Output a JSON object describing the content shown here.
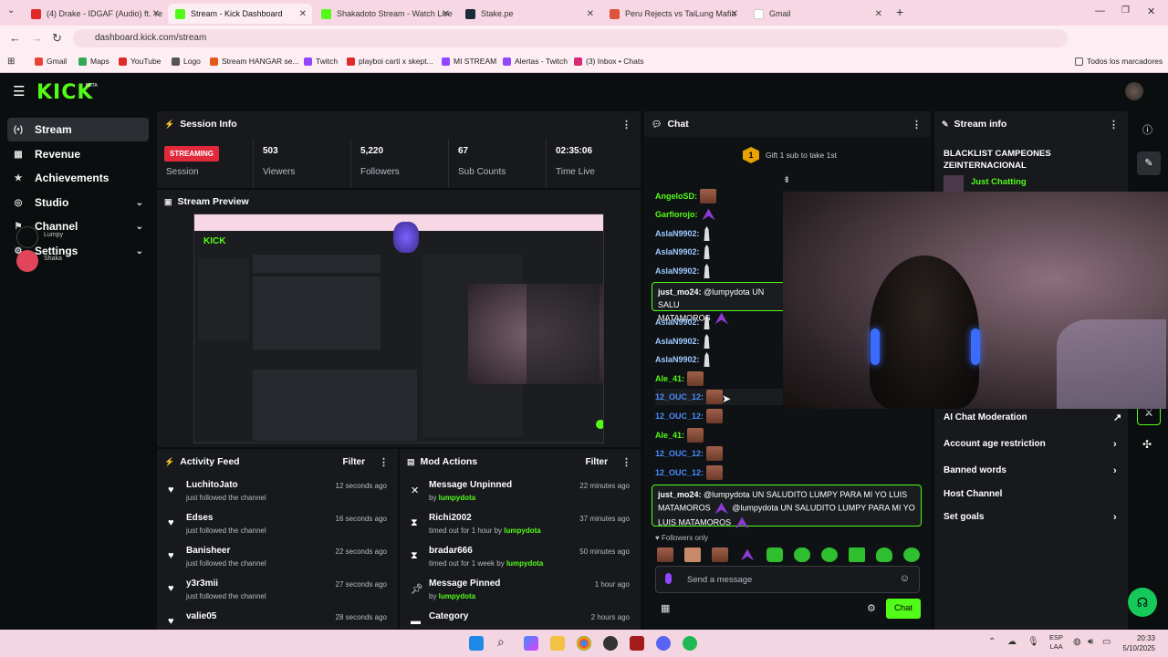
{
  "browser": {
    "tabs": [
      {
        "label": "(4) Drake - IDGAF (Audio) ft. Ye",
        "color": "#e02a2a"
      },
      {
        "label": "Stream - Kick Dashboard",
        "color": "#53fc18",
        "active": true
      },
      {
        "label": "Shakadoto Stream - Watch Live",
        "color": "#53fc18"
      },
      {
        "label": "Stake.pe",
        "color": "#1a2c38"
      },
      {
        "label": "Peru Rejects vs TaiLung Mafia",
        "color": "#e0533b"
      },
      {
        "label": "Gmail",
        "color": "#ffffff"
      }
    ],
    "url": "dashboard.kick.com/stream",
    "bookmarks": [
      "Gmail",
      "Maps",
      "YouTube",
      "Logo",
      "Stream HANGAR se...",
      "Twitch",
      "playboi carti x skept...",
      "MI STREAM",
      "Alertas - Twitch",
      "(3) Inbox • Chats"
    ],
    "bookmarks_all": "Todos los marcadores"
  },
  "sidebar": {
    "items": [
      {
        "label": "Stream",
        "icon": "broadcast-icon"
      },
      {
        "label": "Revenue",
        "icon": "revenue-icon"
      },
      {
        "label": "Achievements",
        "icon": "trophy-icon"
      },
      {
        "label": "Studio",
        "icon": "studio-icon"
      },
      {
        "label": "Channel",
        "icon": "channel-icon"
      },
      {
        "label": "Settings",
        "icon": "gear-icon"
      }
    ],
    "overlay_users": [
      "Lumpy",
      "Shaka"
    ]
  },
  "session": {
    "title": "Session Info",
    "status": "STREAMING",
    "status_label": "Session",
    "stats": [
      {
        "value": "503",
        "label": "Viewers"
      },
      {
        "value": "5,220",
        "label": "Followers"
      },
      {
        "value": "67",
        "label": "Sub Counts"
      },
      {
        "value": "02:35:06",
        "label": "Time Live"
      }
    ]
  },
  "preview": {
    "title": "Stream Preview"
  },
  "activity": {
    "title": "Activity Feed",
    "filter": "Filter",
    "items": [
      {
        "name": "LuchitoJato",
        "sub": "just followed the channel",
        "time": "12 seconds ago"
      },
      {
        "name": "Edses",
        "sub": "just followed the channel",
        "time": "16 seconds ago"
      },
      {
        "name": "Banisheer",
        "sub": "just followed the channel",
        "time": "22 seconds ago"
      },
      {
        "name": "y3r3mii",
        "sub": "just followed the channel",
        "time": "27 seconds ago"
      },
      {
        "name": "valie05",
        "sub": "",
        "time": "28 seconds ago"
      }
    ]
  },
  "mod": {
    "title": "Mod Actions",
    "filter": "Filter",
    "items": [
      {
        "name": "Message Unpinned",
        "sub_pre": "by ",
        "by": "lumpydota",
        "time": "22 minutes ago",
        "icon": "unpin-icon"
      },
      {
        "name": "Richi2002",
        "sub_pre": "timed out for 1 hour by ",
        "by": "lumpydota",
        "time": "37 minutes ago",
        "icon": "hourglass-icon"
      },
      {
        "name": "bradar666",
        "sub_pre": "timed out for 1 week by ",
        "by": "lumpydota",
        "time": "50 minutes ago",
        "icon": "hourglass-icon"
      },
      {
        "name": "Message Pinned",
        "sub_pre": "by ",
        "by": "lumpydota",
        "time": "1 hour ago",
        "icon": "pin-icon"
      },
      {
        "name": "Category",
        "sub_pre": "",
        "by": "",
        "time": "2 hours ago",
        "icon": "category-icon"
      }
    ]
  },
  "chat": {
    "title": "Chat",
    "gift_count": "1",
    "gift_text": "Gift 1 sub to take 1st",
    "lines": [
      {
        "user": "AngeloSD:",
        "color": "#53fc18",
        "emote": "face"
      },
      {
        "user": "Garfiorojo:",
        "color": "#53fc18",
        "emote": "purple"
      },
      {
        "user": "AslaN9902:",
        "color": "#9ec9ff",
        "emote": "hands"
      },
      {
        "user": "AslaN9902:",
        "color": "#9ec9ff",
        "emote": "hands"
      },
      {
        "user": "AslaN9902:",
        "color": "#9ec9ff",
        "emote": "hands"
      }
    ],
    "lines2": [
      {
        "user": "AslaN9902:",
        "color": "#9ec9ff",
        "emote": "hands"
      },
      {
        "user": "AslaN9902:",
        "color": "#9ec9ff",
        "emote": "hands"
      },
      {
        "user": "AslaN9902:",
        "color": "#9ec9ff",
        "emote": "hands"
      },
      {
        "user": "Ale_41:",
        "color": "#53fc18",
        "emote": "face"
      },
      {
        "user": "12_OUC_12:",
        "color": "#4a8cff",
        "emote": "face"
      },
      {
        "user": "12_OUC_12:",
        "color": "#4a8cff",
        "emote": "face"
      },
      {
        "user": "Ale_41:",
        "color": "#53fc18",
        "emote": "face"
      },
      {
        "user": "12_OUC_12:",
        "color": "#4a8cff",
        "emote": "face"
      },
      {
        "user": "12_OUC_12:",
        "color": "#4a8cff",
        "emote": "face"
      }
    ],
    "highlight1": {
      "user": "just_mo24:",
      "text": "@lumpydota UN SALU",
      "text2": "MATAMOROS"
    },
    "highlight2": {
      "user": "just_mo24:",
      "text": "@lumpydota UN SALUDITO LUMPY PARA MI YO LUIS",
      "text2": "MATAMOROS",
      "text3": "@lumpydota UN SALUDITO LUMPY PARA MI YO",
      "text4": "LUIS MATAMOROS"
    },
    "followers_only": "Followers only",
    "placeholder": "Send a message",
    "send": "Chat"
  },
  "stream_info": {
    "title": "Stream info",
    "stream_title": "BLACKLIST CAMPEONES ZEINTERNACIONAL",
    "category": "Just Chatting",
    "actions": [
      {
        "label": "AI Chat Moderation",
        "icon": "external-icon"
      },
      {
        "label": "Account age restriction",
        "icon": "chevron-right-icon"
      },
      {
        "label": "Banned words",
        "icon": "chevron-right-icon"
      },
      {
        "label": "Host Channel",
        "icon": ""
      },
      {
        "label": "Set goals",
        "icon": "chevron-right-icon"
      }
    ]
  },
  "taskbar": {
    "lang": "ESP",
    "lang2": "LAA",
    "time": "20:33",
    "date": "5/10/2025"
  },
  "accent": "#53fc18"
}
